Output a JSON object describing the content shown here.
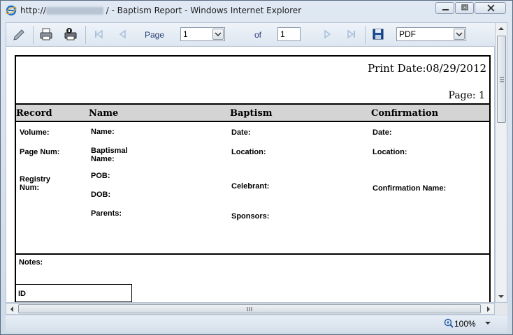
{
  "window": {
    "title_prefix": "http://",
    "title_suffix": " / - Baptism Report - Windows Internet Explorer"
  },
  "toolbar": {
    "page_label": "Page",
    "page_value": "1",
    "of_label": "of",
    "total_pages": "1",
    "export_format": "PDF"
  },
  "report": {
    "print_date": "Print Date:08/29/2012",
    "page_no": "Page: 1",
    "columns": [
      "Record",
      "Name",
      "Baptism",
      "Confirmation"
    ],
    "record": {
      "volume": "Volume:",
      "page_num": "Page Num:",
      "registry_num": "Registry\nNum:"
    },
    "name": {
      "name": "Name:",
      "baptismal_name": "Baptismal\nName:",
      "pob": "POB:",
      "dob": "DOB:",
      "parents": "Parents:"
    },
    "baptism": {
      "date": "Date:",
      "location": "Location:",
      "celebrant": "Celebrant:",
      "sponsors": "Sponsors:"
    },
    "confirmation": {
      "date": "Date:",
      "location": "Location:",
      "conf_name": "Confirmation Name:"
    },
    "notes": "Notes:",
    "id": "ID"
  },
  "status": {
    "zoom": "100%"
  },
  "colors": {
    "accent": "#2a3f78",
    "header_bg": "#d4d4d4"
  }
}
